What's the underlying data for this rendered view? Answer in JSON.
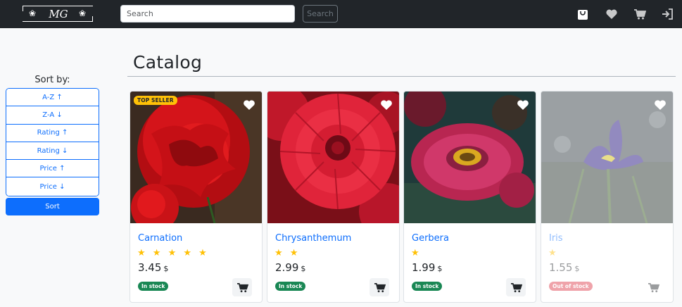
{
  "navbar": {
    "logo_text": "MG",
    "search_placeholder": "Search",
    "search_button": "Search",
    "icons": [
      "shopping-bag-icon",
      "heart-icon",
      "cart-icon",
      "sign-out-icon"
    ]
  },
  "sidebar": {
    "sort_label": "Sort by:",
    "options": [
      {
        "label": "A-Z ↑"
      },
      {
        "label": "Z-A ↓"
      },
      {
        "label": "Rating ↑"
      },
      {
        "label": "Rating ↓"
      },
      {
        "label": "Price ↑"
      },
      {
        "label": "Price ↓"
      }
    ],
    "sort_button": "Sort"
  },
  "main": {
    "title": "Catalog",
    "products": [
      {
        "name": "Carnation",
        "stars": "★ ★ ★ ★ ★",
        "rating": 5,
        "price": "3.45",
        "currency": "$",
        "stock": "In stock",
        "badge": "TOP SELLER",
        "available": true
      },
      {
        "name": "Chrysanthemum",
        "stars": "★ ★",
        "rating": 2,
        "price": "2.99",
        "currency": "$",
        "stock": "In stock",
        "available": true
      },
      {
        "name": "Gerbera",
        "stars": "★",
        "rating": 1,
        "price": "1.99",
        "currency": "$",
        "stock": "In stock",
        "available": true
      },
      {
        "name": "Iris",
        "stars": "★",
        "rating": 1,
        "price": "1.55",
        "currency": "$",
        "stock": "Out of stock",
        "available": false
      }
    ]
  },
  "colors": {
    "navbar": "#212529",
    "primary": "#0d6efd",
    "success": "#198754",
    "danger": "#dc3545",
    "warning": "#ffc107"
  }
}
